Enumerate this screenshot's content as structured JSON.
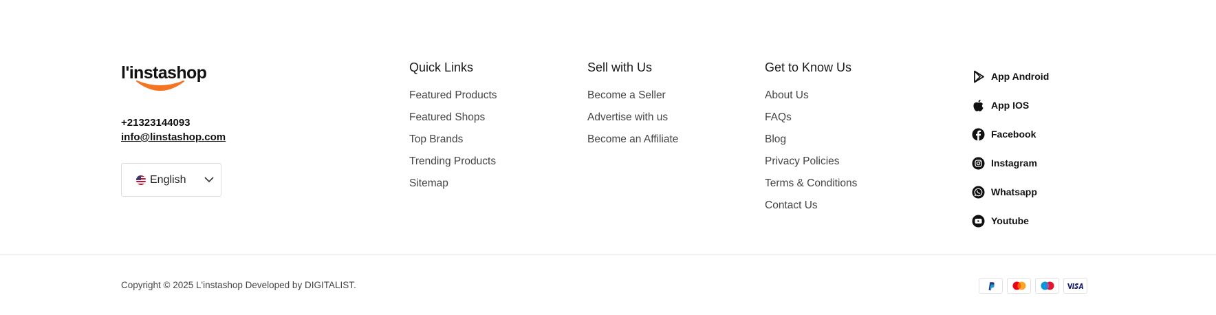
{
  "brand": {
    "logo_text": "l'instashop",
    "phone": "+21323144093",
    "email": "info@linstashop.com",
    "language": {
      "selected": "English",
      "flag_icon": "us-flag-icon"
    },
    "accent_color": "#f47421"
  },
  "columns": [
    {
      "title": "Quick Links",
      "links": [
        "Featured Products",
        "Featured Shops",
        "Top Brands",
        "Trending Products",
        "Sitemap"
      ]
    },
    {
      "title": "Sell with Us",
      "links": [
        "Become a Seller",
        "Advertise with us",
        "Become an Affiliate"
      ]
    },
    {
      "title": "Get to Know Us",
      "links": [
        "About Us",
        "FAQs",
        "Blog",
        "Privacy Policies",
        "Terms & Conditions",
        "Contact Us"
      ]
    }
  ],
  "social": [
    {
      "label": "App Android",
      "icon": "google-play-icon"
    },
    {
      "label": "App IOS",
      "icon": "apple-icon"
    },
    {
      "label": "Facebook",
      "icon": "facebook-icon"
    },
    {
      "label": "Instagram",
      "icon": "instagram-icon"
    },
    {
      "label": "Whatsapp",
      "icon": "whatsapp-icon"
    },
    {
      "label": "Youtube",
      "icon": "youtube-icon"
    }
  ],
  "bottom": {
    "copyright": "Copyright © 2025 L'instashop Developed by DIGITALIST.",
    "payment_methods": [
      {
        "name": "PayPal",
        "icon": "paypal-icon"
      },
      {
        "name": "Mastercard",
        "icon": "mastercard-icon"
      },
      {
        "name": "Maestro",
        "icon": "maestro-icon"
      },
      {
        "name": "Visa",
        "icon": "visa-icon"
      }
    ]
  }
}
